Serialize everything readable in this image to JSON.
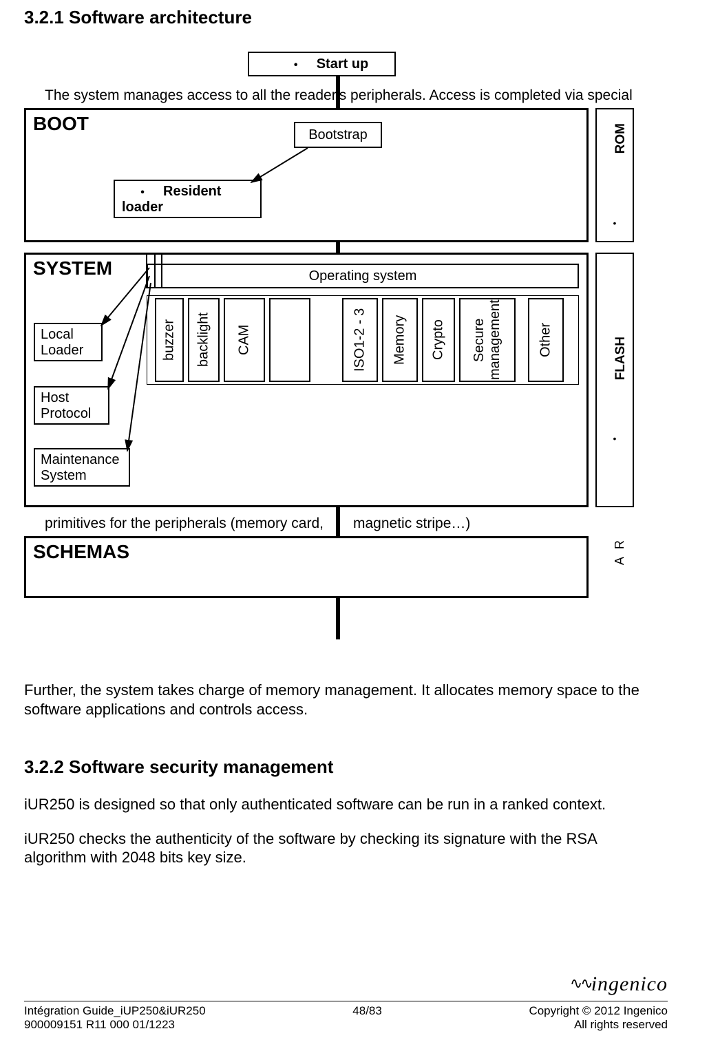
{
  "headings": {
    "section1": "3.2.1 Software architecture",
    "section2": "3.2.2 Software security management"
  },
  "diagram": {
    "startup": "Start up",
    "intro": "The system manages access to all the reader's peripherals. Access is completed via special",
    "boot_title": "BOOT",
    "bootstrap": "Bootstrap",
    "resident_loader": "Resident loader",
    "rom": "ROM",
    "system_title": "SYSTEM",
    "os": "Operating system",
    "local_loader": "Local Loader",
    "host_protocol": "Host Protocol",
    "maintenance": "Maintenance System",
    "flash": "FLASH",
    "modules": {
      "buzzer": "buzzer",
      "backlight": "backlight",
      "cam": "CAM",
      "iso": "ISO1-2 - 3",
      "memory": "Memory",
      "crypto": "Crypto",
      "secure": "Secure management",
      "other": "Other"
    },
    "primitives": "primitives for the peripherals (memory card,",
    "primitives2": "magnetic stripe…)",
    "schemas_title": "SCHEMAS",
    "ra_r": "R",
    "ra_a": "A"
  },
  "body": {
    "p1": "Further, the system takes charge of memory management. It allocates memory space to the software applications and controls access.",
    "p2": "iUR250 is designed so that only authenticated software can be run in a ranked context.",
    "p3": "iUR250 checks the authenticity of the software by checking its signature with the RSA algorithm with 2048 bits key size."
  },
  "footer": {
    "left1": "Intégration Guide_iUP250&iUR250",
    "left2": "900009151 R11 000 01/1223",
    "center": "48/83",
    "right1": "Copyright © 2012 Ingenico",
    "right2": "All rights reserved",
    "logo": "ingenico"
  }
}
